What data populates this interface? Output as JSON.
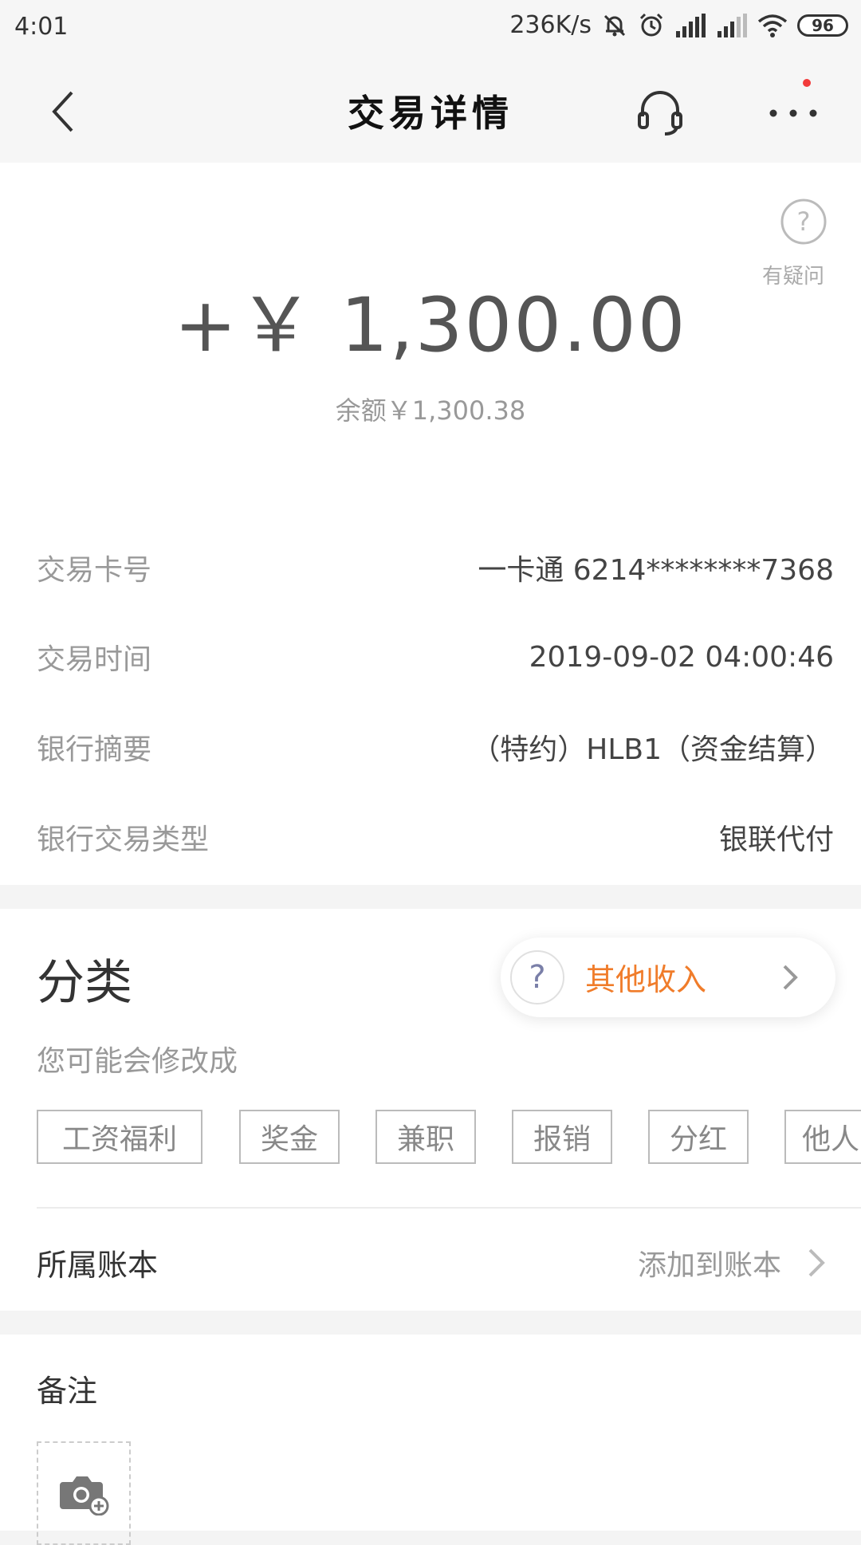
{
  "status_bar": {
    "time": "4:01",
    "speed": "236K/s",
    "battery": "96"
  },
  "nav": {
    "title": "交易详情"
  },
  "amount_section": {
    "help_label": "有疑问",
    "amount": "+￥ 1,300.00",
    "balance": "余额￥1,300.38"
  },
  "details": [
    {
      "label": "交易卡号",
      "value": "一卡通 6214********7368"
    },
    {
      "label": "交易时间",
      "value": "2019-09-02 04:00:46"
    },
    {
      "label": "银行摘要",
      "value": "（特约）HLB1（资金结算）"
    },
    {
      "label": "银行交易类型",
      "value": "银联代付"
    }
  ],
  "category": {
    "title": "分类",
    "current": "其他收入",
    "hint": "您可能会修改成",
    "tags": [
      "工资福利",
      "奖金",
      "兼职",
      "报销",
      "分红",
      "他人"
    ]
  },
  "account_book": {
    "label": "所属账本",
    "action": "添加到账本"
  },
  "note": {
    "label": "备注"
  },
  "colors": {
    "accent": "#f07c2a",
    "notification_dot": "#f23b3b"
  }
}
